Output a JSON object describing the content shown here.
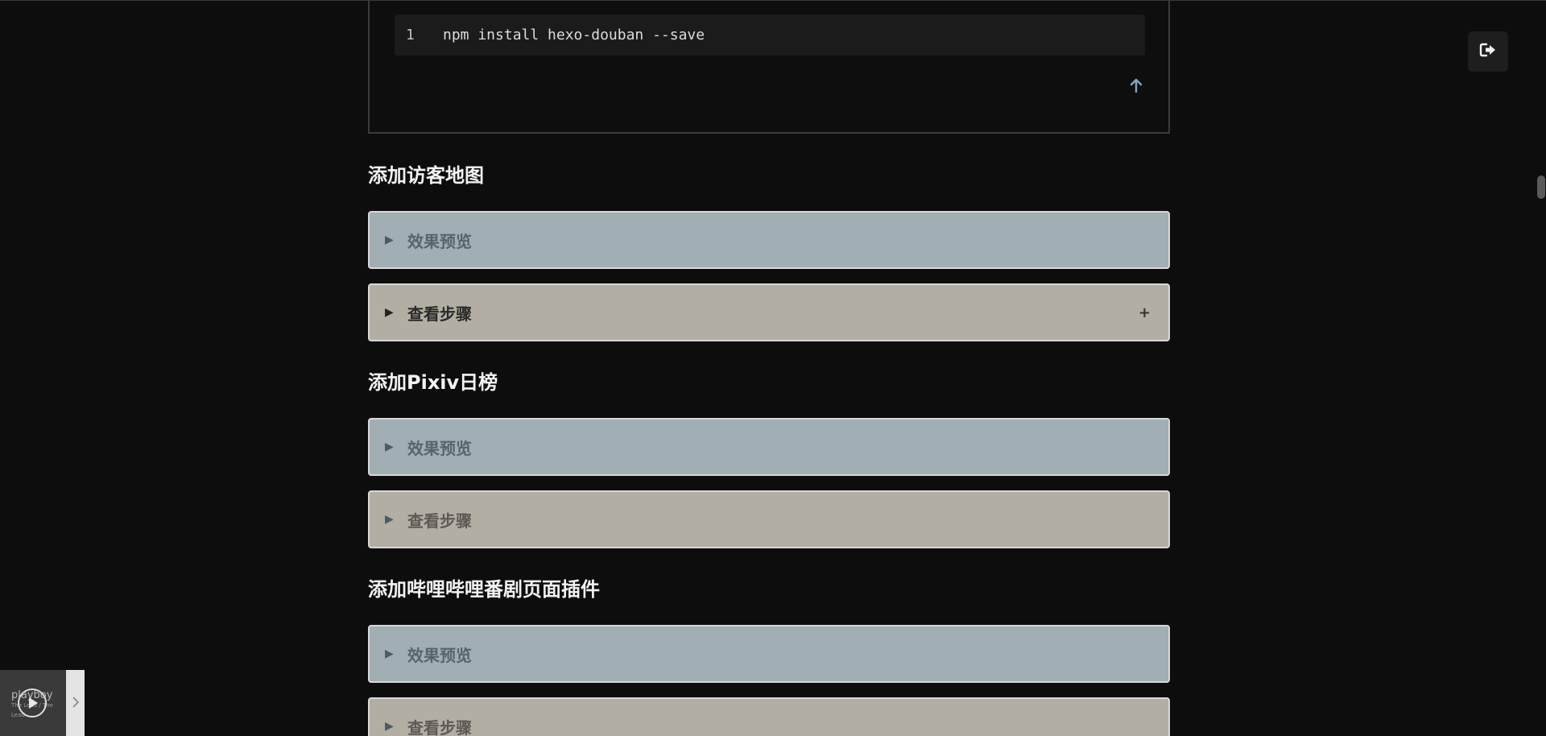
{
  "code_block": {
    "line_number": "1",
    "code": "npm install hexo-douban --save",
    "back_to_top_icon": "arrow-up-icon"
  },
  "sections": [
    {
      "title": "添加访客地图",
      "preview_label": "效果预览",
      "steps_label": "查看步骤"
    },
    {
      "title": "添加Pixiv日榜",
      "preview_label": "效果预览",
      "steps_label": "查看步骤"
    },
    {
      "title": "添加哔哩哔哩番剧页面插件",
      "preview_label": "效果预览",
      "steps_label": "查看步骤"
    }
  ],
  "fold_icon": "triangle-right-icon",
  "expand_icon": "plus-icon",
  "expand_symbol": "+",
  "float_button_icon": "sign-out-icon",
  "player": {
    "cover_title": "playboy",
    "cover_subtitle": "The Lead / The Lead",
    "play_icon": "play-icon",
    "toggle_icon": "chevron-right-icon"
  },
  "colors": {
    "background": "#0d0d0d",
    "preview_panel": "#a1aeb4",
    "steps_panel": "#b3aea3",
    "accent_arrow": "#8aa3c2"
  }
}
